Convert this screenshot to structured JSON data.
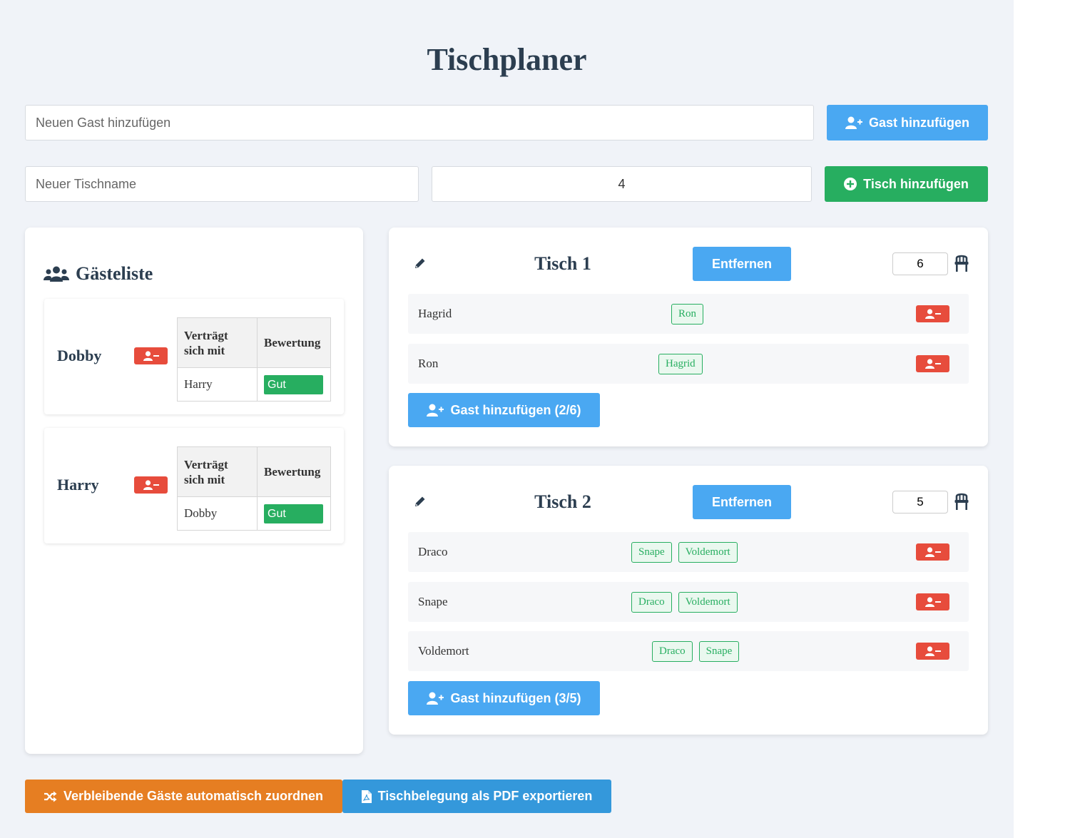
{
  "title": "Tischplaner",
  "guest_input": {
    "placeholder": "Neuen Gast hinzufügen",
    "value": ""
  },
  "add_guest_button": "Gast hinzufügen",
  "table_name_input": {
    "placeholder": "Neuer Tischname",
    "value": ""
  },
  "table_capacity_input": {
    "value": "4"
  },
  "add_table_button": "Tisch hinzufügen",
  "guest_list": {
    "title": "Gästeliste",
    "col_compatible": "Verträgt sich mit",
    "col_rating": "Bewertung",
    "guests": [
      {
        "name": "Dobby",
        "compatible_with": "Harry",
        "rating": "Gut"
      },
      {
        "name": "Harry",
        "compatible_with": "Dobby",
        "rating": "Gut"
      }
    ]
  },
  "tables": [
    {
      "name": "Tisch 1",
      "remove_label": "Entfernen",
      "capacity": "6",
      "guests": [
        {
          "name": "Hagrid",
          "tags": [
            "Ron"
          ]
        },
        {
          "name": "Ron",
          "tags": [
            "Hagrid"
          ]
        }
      ],
      "add_guest_label": "Gast hinzufügen (2/6)"
    },
    {
      "name": "Tisch 2",
      "remove_label": "Entfernen",
      "capacity": "5",
      "guests": [
        {
          "name": "Draco",
          "tags": [
            "Snape",
            "Voldemort"
          ]
        },
        {
          "name": "Snape",
          "tags": [
            "Draco",
            "Voldemort"
          ]
        },
        {
          "name": "Voldemort",
          "tags": [
            "Draco",
            "Snape"
          ]
        }
      ],
      "add_guest_label": "Gast hinzufügen (3/5)"
    }
  ],
  "auto_assign_button": "Verbleibende Gäste automatisch zuordnen",
  "export_pdf_button": "Tischbelegung als PDF exportieren",
  "colors": {
    "primary": "#4aa8f2",
    "success": "#27ae60",
    "danger": "#e74c3c",
    "warning": "#e67e22",
    "export": "#3498db",
    "background": "#f0f3f8",
    "text": "#2c3e50"
  }
}
